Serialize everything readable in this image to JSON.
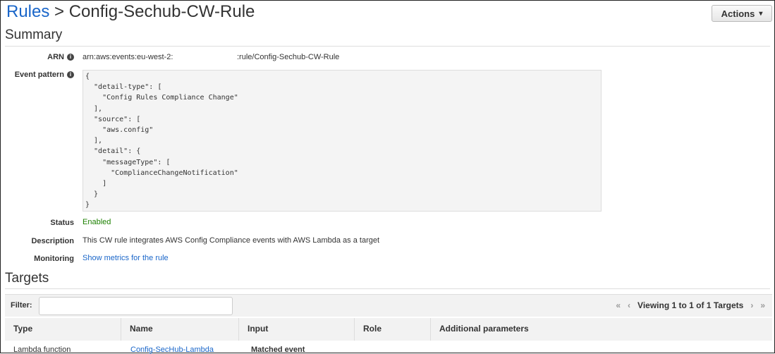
{
  "header": {
    "breadcrumb_link": "Rules",
    "separator": " > ",
    "title": "Config-Sechub-CW-Rule",
    "actions_label": "Actions",
    "actions_caret": "▾"
  },
  "summary": {
    "heading": "Summary",
    "arn_label": "ARN",
    "arn_prefix": "arn:aws:events:eu-west-2:",
    "arn_suffix": ":rule/Config-Sechub-CW-Rule",
    "event_pattern_label": "Event pattern",
    "event_pattern": "{\n  \"detail-type\": [\n    \"Config Rules Compliance Change\"\n  ],\n  \"source\": [\n    \"aws.config\"\n  ],\n  \"detail\": {\n    \"messageType\": [\n      \"ComplianceChangeNotification\"\n    ]\n  }\n}",
    "status_label": "Status",
    "status": "Enabled",
    "description_label": "Description",
    "description": "This CW rule integrates AWS Config Compliance events with AWS Lambda as a target",
    "monitoring_label": "Monitoring",
    "monitoring_link": "Show metrics for the rule"
  },
  "targets": {
    "heading": "Targets",
    "filter_label": "Filter:",
    "filter_value": "",
    "pager_text": "Viewing 1 to 1 of 1 Targets",
    "columns": [
      "Type",
      "Name",
      "Input",
      "Role",
      "Additional parameters"
    ],
    "rows": [
      {
        "type": "Lambda function",
        "name": "Config-SecHub-Lambda",
        "input": "Matched event",
        "role": "",
        "params": ""
      }
    ]
  },
  "colors": {
    "link": "#1a66c9",
    "enabled": "#1d8102"
  }
}
